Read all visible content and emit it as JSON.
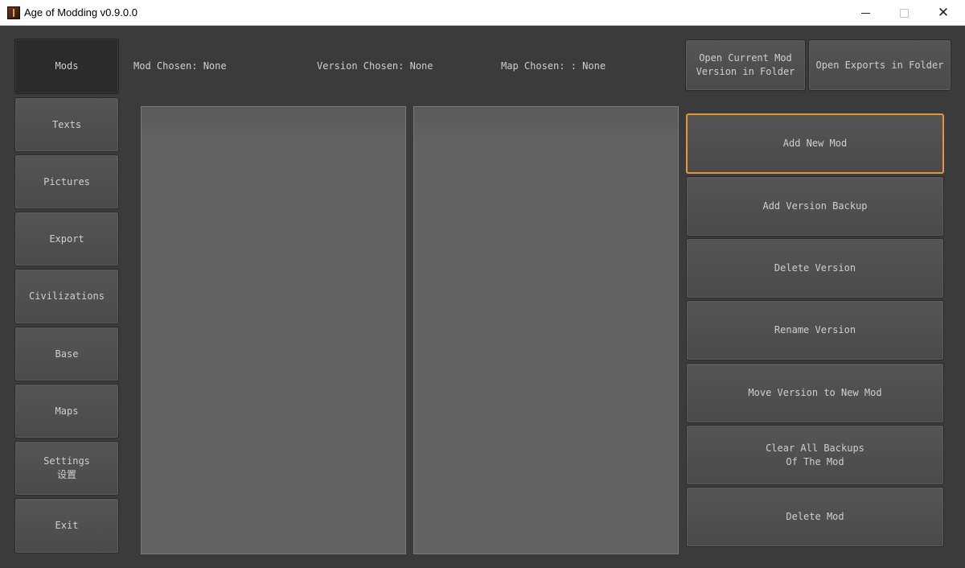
{
  "window": {
    "title": "Age of Modding v0.9.0.0",
    "controls": {
      "minimize": "",
      "maximize": "",
      "close": "✕"
    }
  },
  "sidebar": {
    "items": [
      {
        "label": "Mods",
        "active": true
      },
      {
        "label": "Texts"
      },
      {
        "label": "Pictures"
      },
      {
        "label": "Export"
      },
      {
        "label": "Civilizations"
      },
      {
        "label": "Base"
      },
      {
        "label": "Maps"
      },
      {
        "label": "Settings\n设置"
      },
      {
        "label": "Exit"
      }
    ]
  },
  "status": {
    "mod_chosen": "Mod Chosen: None",
    "version_chosen": "Version Chosen: None",
    "map_chosen": "Map Chosen: : None"
  },
  "top_actions": {
    "open_current": "Open Current Mod\nVersion in Folder",
    "open_exports": "Open Exports in Folder"
  },
  "actions": [
    {
      "label": "Add New Mod",
      "focused": true
    },
    {
      "label": "Add Version Backup"
    },
    {
      "label": "Delete Version"
    },
    {
      "label": "Rename Version"
    },
    {
      "label": "Move Version to New Mod"
    },
    {
      "label": "Clear All Backups\nOf The Mod"
    },
    {
      "label": "Delete Mod"
    }
  ],
  "lists": {
    "mods": [],
    "versions": []
  },
  "colors": {
    "accent_focus": "#e3963a",
    "background": "#3b3b3b",
    "button": "#4f4f4f",
    "list_panel": "#626262",
    "text": "#cfcfcf"
  }
}
